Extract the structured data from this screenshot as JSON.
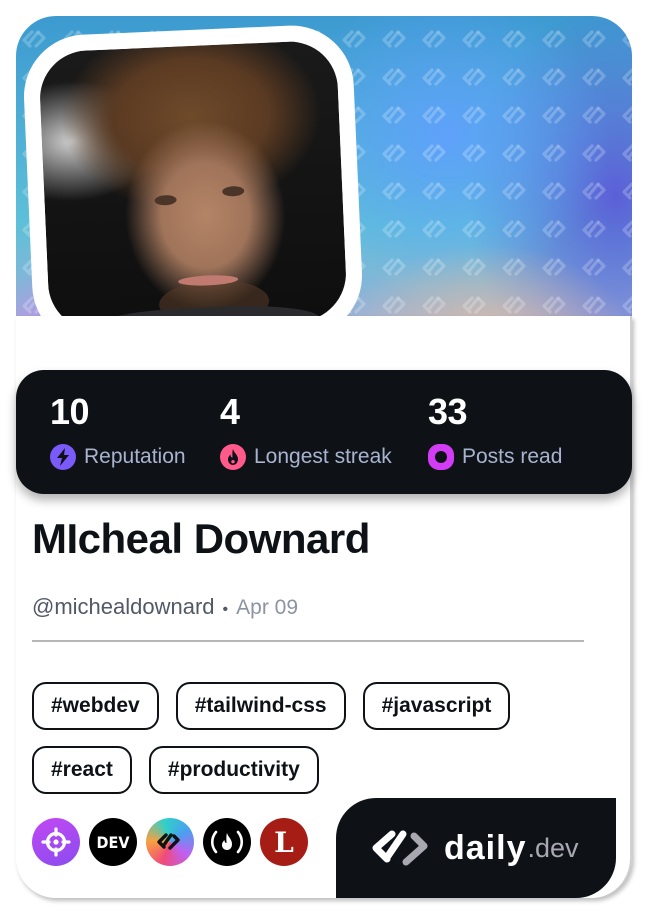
{
  "profile": {
    "name": "MIcheal Downard",
    "handle": "@michealdownard",
    "separator": "•",
    "joined_date": "Apr 09",
    "avatar_alt": "profile-photo"
  },
  "stats": [
    {
      "value": "10",
      "label": "Reputation",
      "icon": "lightning-bolt-icon",
      "color": "#7a5af8"
    },
    {
      "value": "4",
      "label": "Longest streak",
      "icon": "flame-icon",
      "color": "#ff5a8a"
    },
    {
      "value": "33",
      "label": "Posts read",
      "icon": "eye-ring-icon",
      "color": "#d23cf5"
    }
  ],
  "tags": [
    [
      "#webdev",
      "#tailwind-css",
      "#javascript"
    ],
    [
      "#react",
      "#productivity"
    ]
  ],
  "sources": [
    {
      "name": "crosshair-source",
      "icon": "crosshair-icon",
      "color": "#b240f0"
    },
    {
      "name": "dev-to",
      "icon": "dev-logo-icon",
      "label": "DEV",
      "color": "#000000"
    },
    {
      "name": "daily-dev-gradient",
      "icon": "daily-dev-gradient-icon",
      "color": "#e86a9a"
    },
    {
      "name": "freecodecamp",
      "icon": "fire-parentheses-icon",
      "label": "(🔥)",
      "color": "#000000"
    },
    {
      "name": "l-source",
      "icon": "letter-l-icon",
      "label": "L",
      "color": "#a51d14"
    }
  ],
  "brand": {
    "daily": "daily",
    "dev": ".dev"
  }
}
